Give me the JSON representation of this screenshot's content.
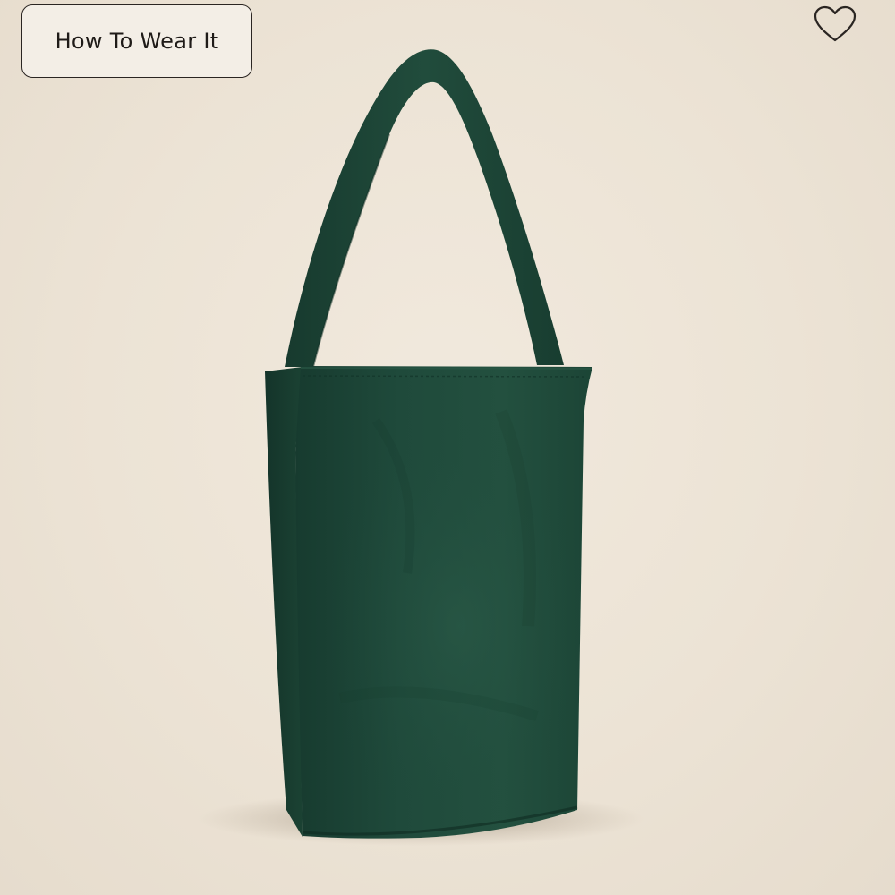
{
  "product_view": {
    "how_to_wear_label": "How To Wear It",
    "favorite_icon": "heart-outline-icon",
    "product_image": "green-suede-tote-bag",
    "colors": {
      "background": "#ece3d5",
      "button_background": "#f3eee6",
      "button_border": "#2a2522",
      "bag_green": "#1f4a3b"
    }
  }
}
